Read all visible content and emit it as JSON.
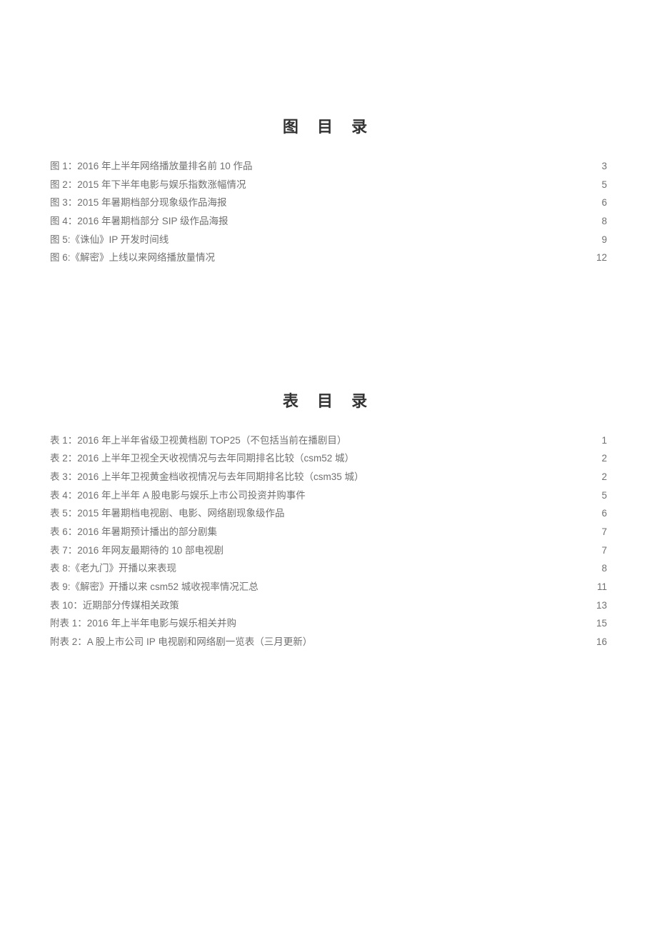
{
  "figures": {
    "title": "图 目 录",
    "items": [
      {
        "label": "图 1：2016 年上半年网络播放量排名前 10 作品",
        "page": "3"
      },
      {
        "label": "图 2：2015 年下半年电影与娱乐指数涨幅情况",
        "page": "5"
      },
      {
        "label": "图 3：2015 年暑期档部分现象级作品海报",
        "page": "6"
      },
      {
        "label": "图 4：2016 年暑期档部分 SIP 级作品海报",
        "page": "8"
      },
      {
        "label": "图 5:《诛仙》IP 开发时间线",
        "page": "9"
      },
      {
        "label": "图 6:《解密》上线以来网络播放量情况",
        "page": "12"
      }
    ]
  },
  "tables": {
    "title": "表 目 录",
    "items": [
      {
        "label": "表 1：2016 年上半年省级卫视黄档剧 TOP25（不包括当前在播剧目）",
        "page": "1"
      },
      {
        "label": "表 2：2016 上半年卫视全天收视情况与去年同期排名比较（csm52 城）",
        "page": "2"
      },
      {
        "label": "表 3：2016 上半年卫视黄金档收视情况与去年同期排名比较（csm35 城）",
        "page": "2"
      },
      {
        "label": "表 4：2016 年上半年 A 股电影与娱乐上市公司投资并购事件",
        "page": "5"
      },
      {
        "label": "表 5：2015 年暑期档电视剧、电影、网络剧现象级作品",
        "page": "6"
      },
      {
        "label": "表 6：2016 年暑期预计播出的部分剧集",
        "page": "7"
      },
      {
        "label": "表 7：2016 年网友最期待的 10 部电视剧",
        "page": "7"
      },
      {
        "label": "表 8:《老九门》开播以来表现",
        "page": "8"
      },
      {
        "label": "表 9:《解密》开播以来 csm52 城收视率情况汇总",
        "page": "11"
      },
      {
        "label": "表 10：近期部分传媒相关政策",
        "page": "13"
      },
      {
        "label": "附表 1：2016 年上半年电影与娱乐相关并购",
        "page": "15"
      },
      {
        "label": "附表 2：A 股上市公司 IP 电视剧和网络剧一览表（三月更新）",
        "page": "16"
      }
    ]
  }
}
